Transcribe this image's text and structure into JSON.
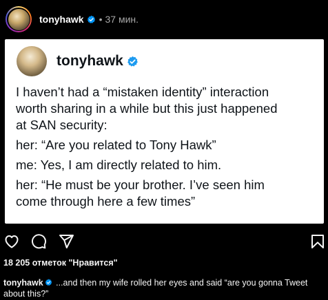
{
  "header": {
    "username": "tonyhawk",
    "separator": "•",
    "time": "37 мин."
  },
  "tweet": {
    "username": "tonyhawk",
    "lines": [
      "I haven’t had a “mistaken identity” interaction",
      "worth sharing in a while but this just happened",
      "at SAN security:",
      "her: “Are you related to Tony Hawk”",
      "me: Yes, I am directly related to him.",
      "her: “He must be your brother. I’ve seen him",
      "come through here a few times”"
    ]
  },
  "actions": {
    "icons": [
      "heart-icon",
      "comment-icon",
      "share-icon",
      "bookmark-icon"
    ]
  },
  "likes": {
    "text": "18 205 отметок \"Нравится\""
  },
  "caption": {
    "username": "tonyhawk",
    "text": "...and then my wife rolled her eyes and said “are you gonna Tweet about this?”"
  },
  "colors": {
    "background": "#000000",
    "verified": "#0095f6",
    "tweet_verified": "#1d9bf0",
    "secondary_text": "#a8a8a8"
  }
}
